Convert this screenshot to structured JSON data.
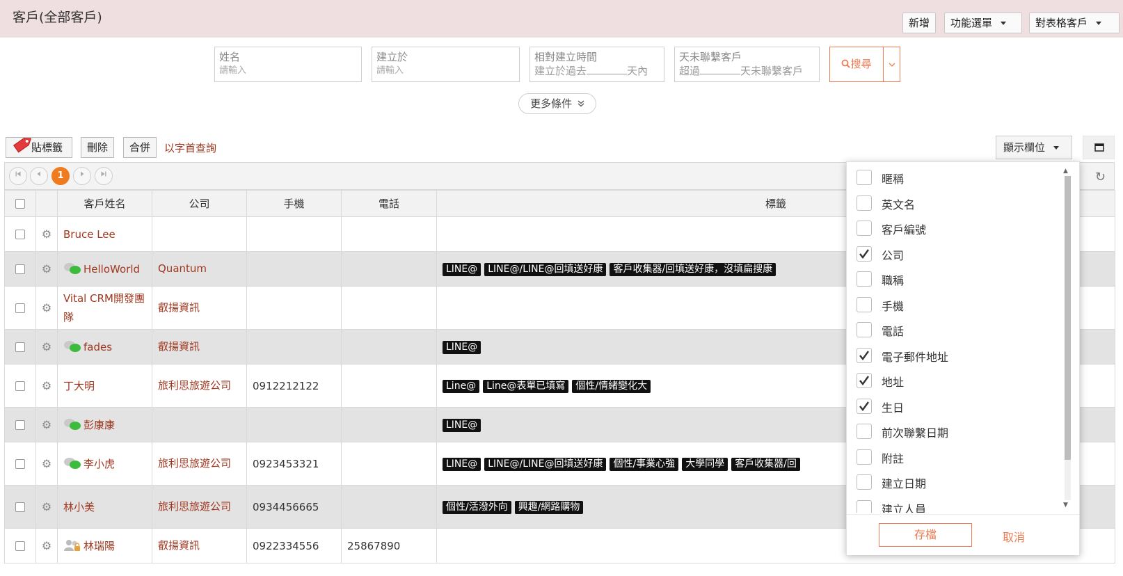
{
  "header": {
    "title": "客戶(全部客戶)",
    "add_label": "新增",
    "function_menu_label": "功能選單",
    "sheet_label": "對表格客戶"
  },
  "search": {
    "name_label": "姓名",
    "name_placeholder": "請輸入",
    "created_label": "建立於",
    "created_placeholder": "請輸入",
    "relative_label": "相對建立時間",
    "relative_prefix": "建立於過去",
    "relative_suffix": "天內",
    "nocontact_label": "天未聯繫客戶",
    "nocontact_prefix": "超過",
    "nocontact_suffix": "天未聯繫客戶",
    "search_button": "搜尋",
    "more_conditions": "更多條件"
  },
  "toolbar": {
    "tag_label": "貼標籤",
    "delete_label": "刪除",
    "merge_label": "合併",
    "letter_query_label": "以字首查詢",
    "show_columns_label": "顯示欄位"
  },
  "pager": {
    "current_page": "1"
  },
  "columns": {
    "name": "客戶姓名",
    "company": "公司",
    "mobile": "手機",
    "phone": "電話",
    "tags": "標籤"
  },
  "rows": [
    {
      "name": "Bruce Lee",
      "company": "",
      "mobile": "",
      "phone": "",
      "tags": []
    },
    {
      "name": "HelloWorld",
      "company": "Quantum",
      "mobile": "",
      "phone": "",
      "tags": [
        "LINE@",
        "LINE@/LINE@回填送好康",
        "客戶收集器/回填送好康，沒填扁搜康"
      ]
    },
    {
      "name": "Vital CRM開發團隊",
      "company": "叡揚資訊",
      "mobile": "",
      "phone": "",
      "tags": []
    },
    {
      "name": "fades",
      "company": "叡揚資訊",
      "mobile": "",
      "phone": "",
      "tags": [
        "LINE@"
      ]
    },
    {
      "name": "丁大明",
      "company": "旅利思旅遊公司",
      "mobile": "0912212122",
      "phone": "",
      "tags": [
        "Line@",
        "Line@表單已填寫",
        "個性/情緒變化大"
      ]
    },
    {
      "name": "彭康康",
      "company": "",
      "mobile": "",
      "phone": "",
      "tags": [
        "LINE@"
      ]
    },
    {
      "name": "李小虎",
      "company": "旅利思旅遊公司",
      "mobile": "0923453321",
      "phone": "",
      "tags": [
        "LINE@",
        "LINE@/LINE@回填送好康",
        "個性/事業心強",
        "大學同學",
        "客戶收集器/回"
      ]
    },
    {
      "name": "林小美",
      "company": "旅利思旅遊公司",
      "mobile": "0934456665",
      "phone": "",
      "tags": [
        "個性/活潑外向",
        "興趣/網路購物"
      ]
    },
    {
      "name": "林瑞陽",
      "company": "叡揚資訊",
      "mobile": "0922334556",
      "phone": "25867890",
      "tags": []
    }
  ],
  "column_chooser": {
    "items": [
      {
        "label": "暱稱",
        "checked": false
      },
      {
        "label": "英文名",
        "checked": false
      },
      {
        "label": "客戶編號",
        "checked": false
      },
      {
        "label": "公司",
        "checked": true
      },
      {
        "label": "職稱",
        "checked": false
      },
      {
        "label": "手機",
        "checked": false
      },
      {
        "label": "電話",
        "checked": false
      },
      {
        "label": "電子郵件地址",
        "checked": true
      },
      {
        "label": "地址",
        "checked": true
      },
      {
        "label": "生日",
        "checked": true
      },
      {
        "label": "前次聯繫日期",
        "checked": false
      },
      {
        "label": "附註",
        "checked": false
      },
      {
        "label": "建立日期",
        "checked": false
      },
      {
        "label": "建立人員",
        "checked": false
      }
    ],
    "save_label": "存檔",
    "cancel_label": "取消"
  },
  "colors": {
    "accent": "#f07b52",
    "link": "#a0371f",
    "header_bg": "#efdfe0"
  }
}
